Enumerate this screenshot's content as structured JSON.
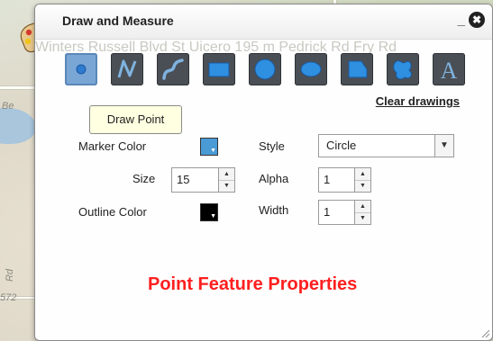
{
  "map": {
    "labels": [
      "Winters",
      "Russell Blvd",
      "St Uicero",
      "Be",
      "195 m",
      "Pedrick Rd",
      "Fry Rd",
      "Rd",
      "572"
    ]
  },
  "dialog": {
    "title": "Draw and Measure",
    "minimize_label": "_",
    "close_label": "✖"
  },
  "tools": [
    {
      "name": "Draw Point",
      "icon": "point-icon",
      "selected": true
    },
    {
      "name": "Draw Polyline",
      "icon": "polyline-icon",
      "selected": false
    },
    {
      "name": "Draw Freehand Polyline",
      "icon": "freehand-polyline-icon",
      "selected": false
    },
    {
      "name": "Draw Rectangle",
      "icon": "rectangle-icon",
      "selected": false
    },
    {
      "name": "Draw Circle",
      "icon": "circle-icon",
      "selected": false
    },
    {
      "name": "Draw Ellipse",
      "icon": "ellipse-icon",
      "selected": false
    },
    {
      "name": "Draw Polygon",
      "icon": "polygon-icon",
      "selected": false
    },
    {
      "name": "Draw Freehand Polygon",
      "icon": "freehand-polygon-icon",
      "selected": false
    },
    {
      "name": "Add Text",
      "icon": "text-icon",
      "glyph": "A",
      "selected": false
    }
  ],
  "clear_drawings": "Clear drawings",
  "tooltip": "Draw Point",
  "properties": {
    "marker_color_label": "Marker Color",
    "marker_color": "#4a9ad6",
    "size_label": "Size",
    "size_value": "15",
    "outline_color_label": "Outline Color",
    "outline_color": "#000000",
    "style_label": "Style",
    "style_value": "Circle",
    "alpha_label": "Alpha",
    "alpha_value": "1",
    "width_label": "Width",
    "width_value": "1"
  },
  "caption": "Point Feature Properties",
  "colors": {
    "accent": "#7aa6d6",
    "tool_bg": "#4a4f55",
    "tool_icon": "#7fb3e0",
    "caption": "#ff1f1f"
  }
}
